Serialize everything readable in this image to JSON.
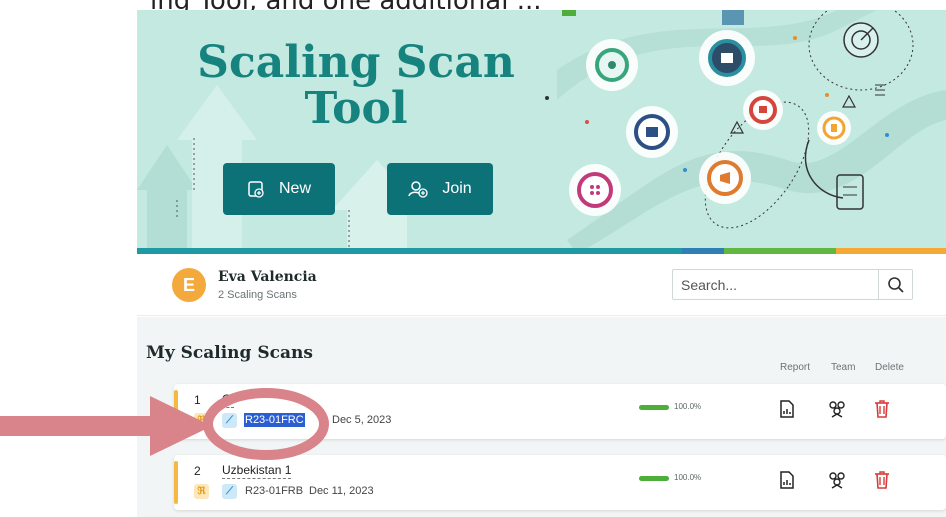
{
  "header_partial_text": "ing Tool, and one additional ...",
  "hero": {
    "title_line1": "Scaling Scan",
    "title_line2": "Tool",
    "new_button": "New",
    "join_button": "Join",
    "colors": {
      "background": "#c4e9e1",
      "title": "#16837f",
      "button": "#0d7278"
    }
  },
  "user": {
    "avatar_letter": "E",
    "name": "Eva Valencia",
    "subtitle": "2 Scaling Scans"
  },
  "search": {
    "placeholder": "Search..."
  },
  "list": {
    "title": "My Scaling Scans",
    "columns": {
      "report": "Report",
      "team": "Team",
      "delete": "Delete"
    },
    "rows": [
      {
        "number": "1",
        "name": "Ol",
        "code": "R23-01FRC",
        "date": "Dec 5, 2023",
        "progress": 1.0,
        "progress_label": "100.0%"
      },
      {
        "number": "2",
        "name": "Uzbekistan 1",
        "code": "R23-01FRB",
        "date": "Dec 11, 2023",
        "progress": 1.0,
        "progress_label": "100.0%"
      }
    ]
  },
  "annotation": {
    "arrow_color": "#d9838a",
    "circle_color": "#d9838a"
  },
  "icons": [
    "plus-file-icon",
    "add-user-icon",
    "search-icon",
    "report-icon",
    "team-icon",
    "trash-icon",
    "scan-type-icon",
    "link-icon"
  ]
}
